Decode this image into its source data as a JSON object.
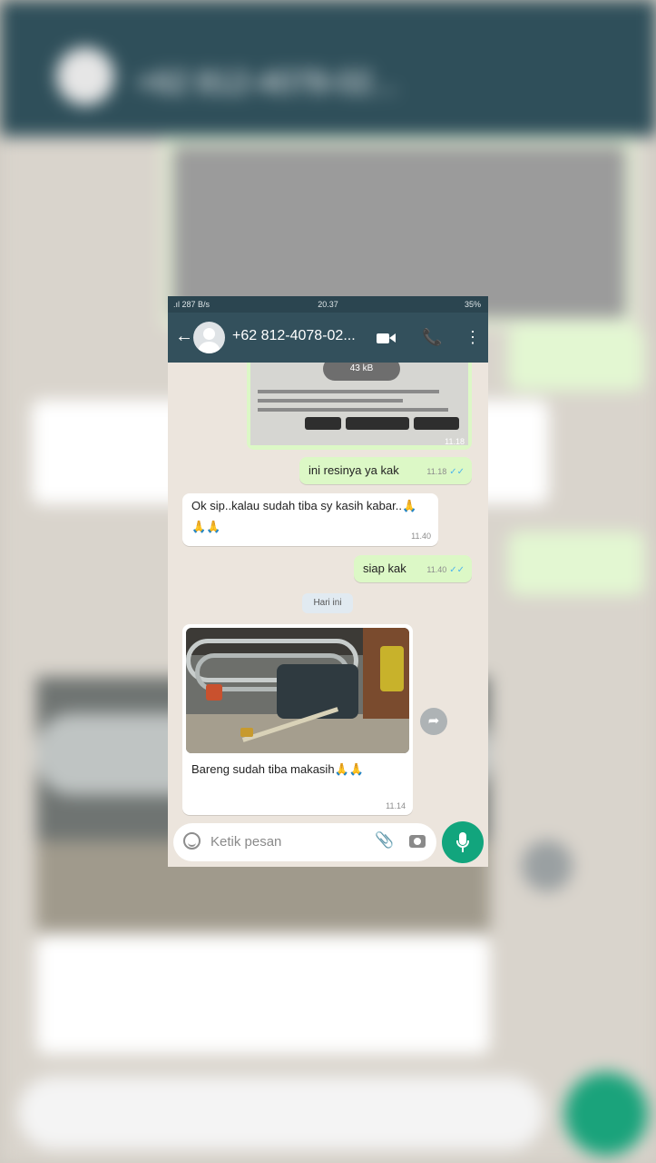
{
  "status_bar": {
    "network": ".ıl 287 B/s",
    "time": "20.37",
    "battery": "35%"
  },
  "header": {
    "back_icon": "arrow-back-icon",
    "contact_name": "+62 812-4078-02...",
    "video_icon": "video-call-icon",
    "call_icon": "phone-call-icon",
    "menu_icon": "more-vert-icon"
  },
  "messages": [
    {
      "type": "image",
      "direction": "out",
      "overlay": "43 kB",
      "time": "11.18"
    },
    {
      "type": "text",
      "direction": "out",
      "text": "ini resinya ya kak",
      "time": "11.18",
      "ticks": "✓✓"
    },
    {
      "type": "text",
      "direction": "in",
      "text": "Ok sip..kalau sudah tiba sy kasih kabar..🙏🙏🙏",
      "time": "11.40"
    },
    {
      "type": "text",
      "direction": "out",
      "text": "siap kak",
      "time": "11.40",
      "ticks": "✓✓"
    },
    {
      "type": "text",
      "direction": "in",
      "text": "Bareng sudah tiba makasih🙏🙏",
      "time": "11.14"
    }
  ],
  "day_separator": "Hari ini",
  "input": {
    "placeholder": "Ketik pesan",
    "emoji_icon": "emoji-icon",
    "attach_icon": "paperclip-icon",
    "camera_icon": "camera-icon",
    "mic_icon": "mic-icon"
  },
  "colors": {
    "header": "#33505c",
    "outgoing_bubble": "#dcf8c6",
    "incoming_bubble": "#ffffff",
    "chat_background": "#ece5dd",
    "mic_button": "#12a57d",
    "read_ticks": "#4fb6ec"
  }
}
